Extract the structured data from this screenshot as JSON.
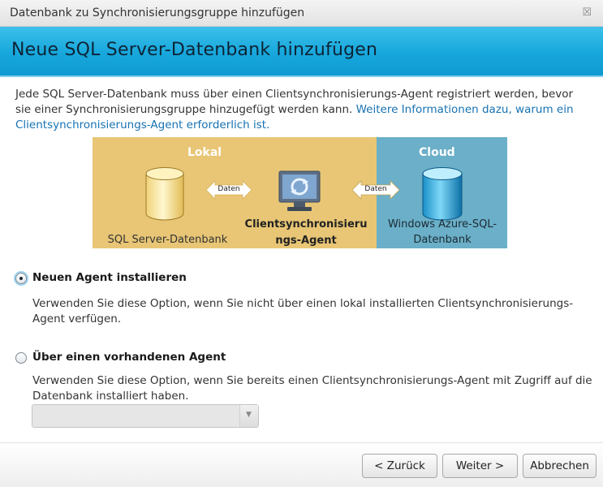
{
  "window": {
    "title": "Datenbank zu Synchronisierungsgruppe hinzufügen",
    "close_glyph": "☒"
  },
  "banner": {
    "heading": "Neue SQL Server-Datenbank hinzufügen"
  },
  "intro": {
    "line1": "Jede SQL Server-Datenbank muss über einen Clientsynchronisierungs-Agent registriert werden, bevor sie einer Synchronisierungsgruppe hinzugefügt werden kann.",
    "link": "Weitere Informationen dazu, warum ein Clientsynchronisierungs-Agent erforderlich ist."
  },
  "diagram": {
    "lokal_label": "Lokal",
    "cloud_label": "Cloud",
    "arrow_left_label": "Daten",
    "arrow_right_label": "Daten",
    "sql_label": "SQL Server-Datenbank",
    "agent_label_1": "Clientsynchronisieru",
    "agent_label_2": "ngs-Agent",
    "azure_label_1": "Windows Azure-SQL-",
    "azure_label_2": "Datenbank",
    "colors": {
      "lokal": "#e8c675",
      "cloud": "#6bafc8"
    }
  },
  "options": {
    "new_agent": {
      "label": "Neuen Agent installieren",
      "desc": "Verwenden Sie diese Option, wenn Sie nicht über einen lokal installierten Clientsynchronisierungs-Agent verfügen.",
      "selected": true
    },
    "existing_agent": {
      "label": "Über einen vorhandenen Agent",
      "desc": "Verwenden Sie diese Option, wenn Sie bereits einen Clientsynchronisierungs-Agent mit Zugriff auf die Datenbank installiert haben.",
      "selected": false,
      "dropdown_value": ""
    }
  },
  "buttons": {
    "back": "< Zurück",
    "next": "Weiter >",
    "cancel": "Abbrechen"
  }
}
